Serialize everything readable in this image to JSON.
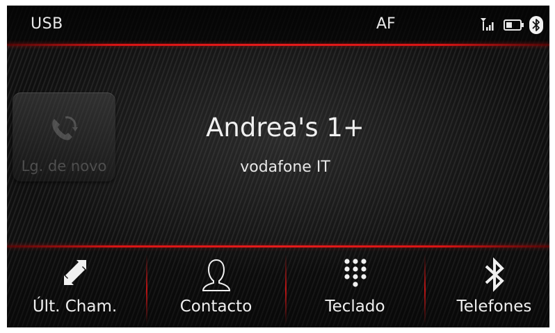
{
  "status_bar": {
    "source": "USB",
    "radio": "AF"
  },
  "redial": {
    "label": "Lg. de novo"
  },
  "call": {
    "device_name": "Andrea's 1+",
    "carrier": "vodafone IT"
  },
  "nav": {
    "items": [
      {
        "label": "Últ. Cham.",
        "icon": "recent-calls-icon"
      },
      {
        "label": "Contacto",
        "icon": "contact-icon"
      },
      {
        "label": "Teclado",
        "icon": "keypad-icon"
      },
      {
        "label": "Telefones",
        "icon": "bluetooth-icon"
      }
    ]
  },
  "colors": {
    "accent": "#e01818",
    "text": "#f0f0f0",
    "background": "#151515"
  }
}
